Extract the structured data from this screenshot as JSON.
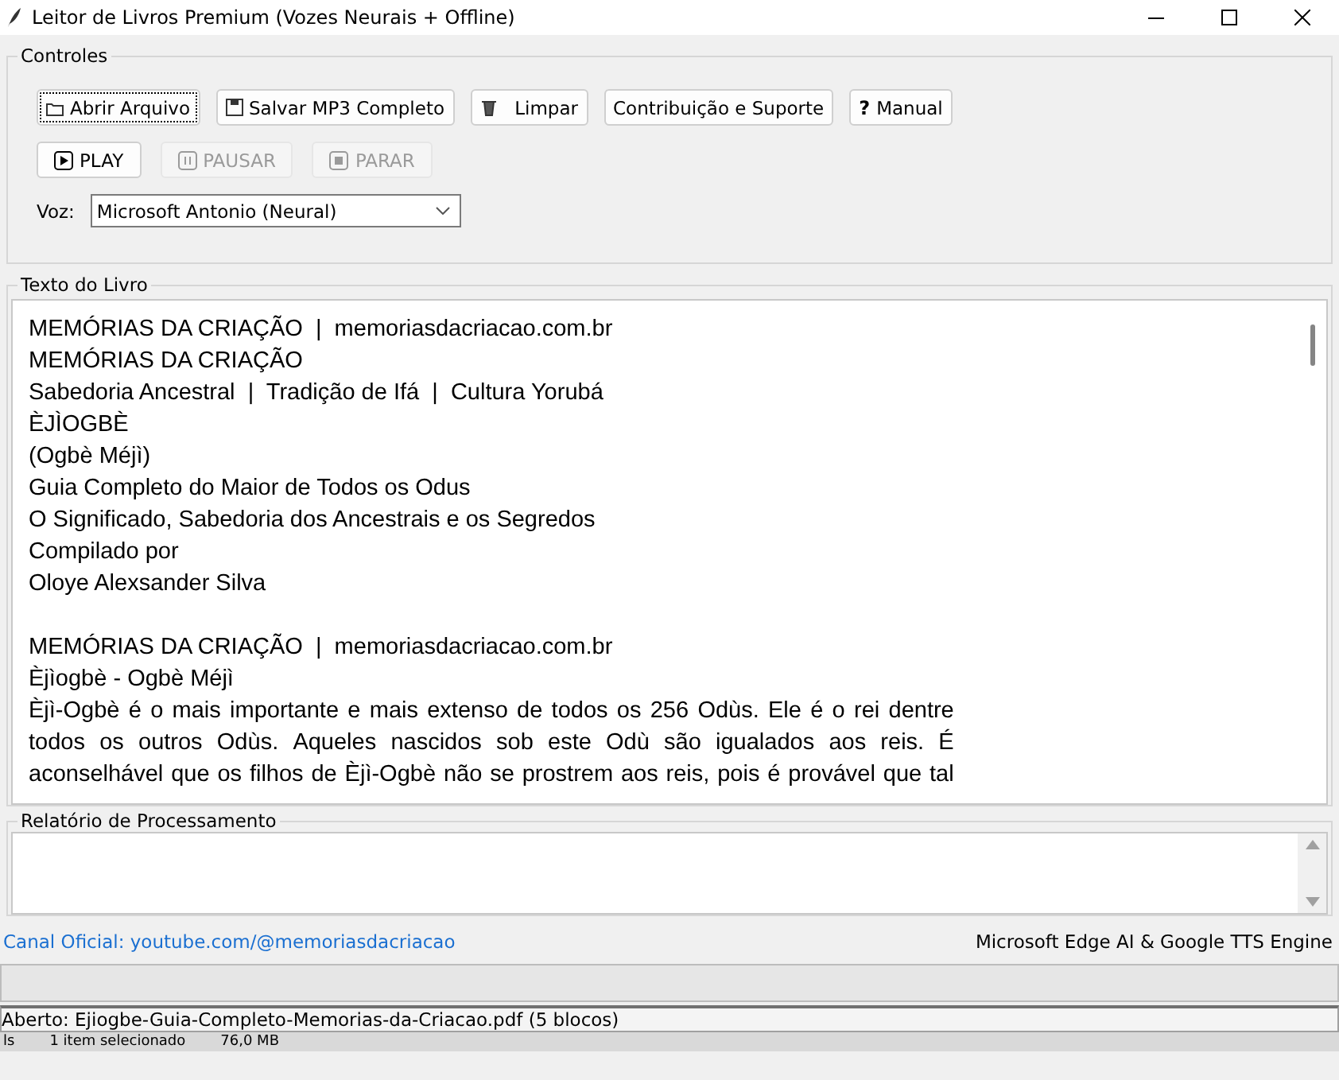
{
  "window": {
    "title": "Leitor de Livros Premium (Vozes Neurais + Offline)"
  },
  "controls": {
    "title": "Controles",
    "buttons": [
      {
        "label": "Abrir Arquivo",
        "kind": "folder",
        "focused": true
      },
      {
        "label": "Salvar MP3 Completo",
        "kind": "floppy",
        "focused": false
      },
      {
        "label": "Limpar",
        "kind": "trash",
        "focused": false
      },
      {
        "label": "Contribuição e Suporte",
        "kind": "plain",
        "focused": false
      },
      {
        "label": "Manual",
        "kind": "glyph",
        "glyph": "?",
        "focused": false
      }
    ],
    "playback": [
      {
        "label": "PLAY",
        "kind": "play",
        "disabled": false
      },
      {
        "label": "PAUSAR",
        "kind": "pause",
        "disabled": true
      },
      {
        "label": "PARAR",
        "kind": "stop",
        "disabled": true
      }
    ],
    "voice": {
      "label": "Voz:",
      "value": "Microsoft Antonio (Neural)"
    }
  },
  "book_text": {
    "title": "Texto do Livro",
    "lines": [
      {
        "kind": "line",
        "text": "MEMÓRIAS DA CRIAÇÃO  |  memoriasdacriacao.com.br"
      },
      {
        "kind": "line",
        "text": "MEMÓRIAS DA CRIAÇÃO"
      },
      {
        "kind": "line",
        "text": "Sabedoria Ancestral  |  Tradição de Ifá  |  Cultura Yorubá"
      },
      {
        "kind": "line",
        "text": "ÈJÌOGBÈ"
      },
      {
        "kind": "line",
        "text": "(Ogbè Méjì)"
      },
      {
        "kind": "line",
        "text": "Guia Completo do Maior de Todos os Odus"
      },
      {
        "kind": "line",
        "text": "O Significado, Sabedoria dos Ancestrais e os Segredos"
      },
      {
        "kind": "line",
        "text": "Compilado por"
      },
      {
        "kind": "line",
        "text": "Oloye Alexsander Silva"
      },
      {
        "kind": "blank"
      },
      {
        "kind": "line",
        "text": "MEMÓRIAS DA CRIAÇÃO  |  memoriasdacriacao.com.br"
      },
      {
        "kind": "line",
        "text": "Èjìogbè - Ogbè Méjì"
      },
      {
        "kind": "justified",
        "text": "Èjì-Ogbè é o mais importante e mais extenso de todos os 256 Odùs. Ele é o rei dentre"
      },
      {
        "kind": "justified",
        "text": "todos os outros Odùs. Aqueles nascidos sob este Odù são igualados aos reis. É"
      },
      {
        "kind": "justified",
        "text": "aconselhável que os filhos de Èjì-Ogbè não se prostrem aos reis, pois é provável que tal"
      }
    ]
  },
  "report": {
    "title": "Relatório de Processamento"
  },
  "footer": {
    "link": "Canal Oficial: youtube.com/@memoriasdacriacao",
    "engine": "Microsoft Edge AI & Google TTS Engine"
  },
  "progress": {
    "level": 0
  },
  "status": "Aberto: Ejiogbe-Guia-Completo-Memorias-da-Criacao.pdf (5 blocos)",
  "behind": {
    "items": [
      "ls",
      "1 item selecionado",
      "76,0 MB"
    ]
  }
}
